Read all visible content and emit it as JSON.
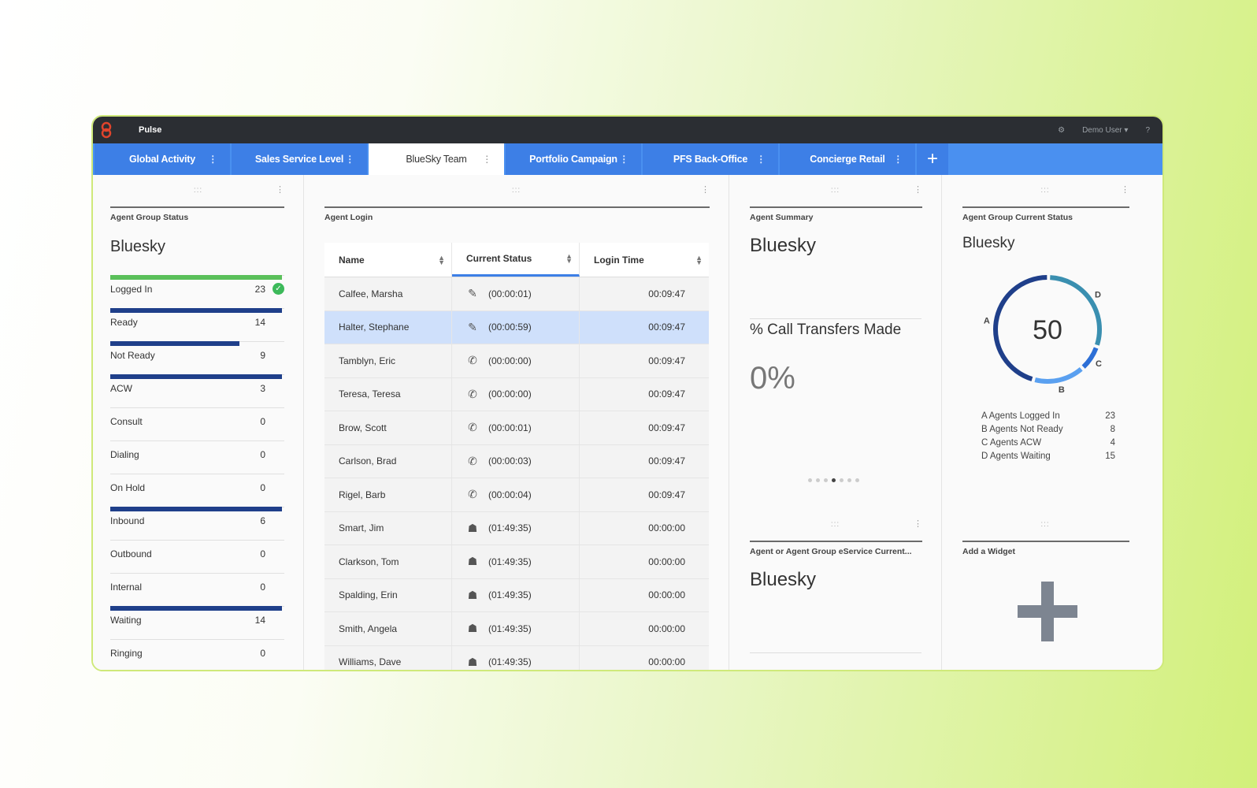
{
  "app": {
    "title": "Pulse",
    "user": "Demo User ▾",
    "help": "?",
    "settings": "⚙"
  },
  "tabs": [
    {
      "label": "Global Activity",
      "active": false
    },
    {
      "label": "Sales Service Level",
      "active": false
    },
    {
      "label": "BlueSky Team",
      "active": true
    },
    {
      "label": "Portfolio Campaign",
      "active": false
    },
    {
      "label": "PFS Back-Office",
      "active": false
    },
    {
      "label": "Concierge Retail",
      "active": false
    }
  ],
  "tab_add": "+",
  "group_status": {
    "header": "Agent Group Status",
    "title": "Bluesky",
    "rows": [
      {
        "label": "Logged In",
        "value": "23",
        "fill": 1.0,
        "color": "#5ac05a"
      },
      {
        "label": "Ready",
        "value": "14",
        "fill": 1.0,
        "color": "#1f3f8a"
      },
      {
        "label": "Not Ready",
        "value": "9",
        "fill": 0.75,
        "color": "#1f3f8a"
      },
      {
        "label": "ACW",
        "value": "3",
        "fill": 1.0,
        "color": "#1f3f8a"
      },
      {
        "label": "Consult",
        "value": "0",
        "fill": 0,
        "color": "#1f3f8a"
      },
      {
        "label": "Dialing",
        "value": "0",
        "fill": 0,
        "color": "#1f3f8a"
      },
      {
        "label": "On Hold",
        "value": "0",
        "fill": 0,
        "color": "#1f3f8a"
      },
      {
        "label": "Inbound",
        "value": "6",
        "fill": 1.0,
        "color": "#1f3f8a"
      },
      {
        "label": "Outbound",
        "value": "0",
        "fill": 0,
        "color": "#1f3f8a"
      },
      {
        "label": "Internal",
        "value": "0",
        "fill": 0,
        "color": "#1f3f8a"
      },
      {
        "label": "Waiting",
        "value": "14",
        "fill": 1.0,
        "color": "#1f3f8a"
      },
      {
        "label": "Ringing",
        "value": "0",
        "fill": 0,
        "color": "#1f3f8a"
      }
    ]
  },
  "agent_login": {
    "header": "Agent Login",
    "columns": [
      "Name",
      "Current Status",
      "Login Time"
    ],
    "rows": [
      {
        "name": "Calfee, Marsha",
        "icon": "edit-icon",
        "status": "(00:00:01)",
        "login": "00:09:47",
        "selected": false
      },
      {
        "name": "Halter, Stephane",
        "icon": "edit-icon",
        "status": "(00:00:59)",
        "login": "00:09:47",
        "selected": true
      },
      {
        "name": "Tamblyn, Eric",
        "icon": "phone-icon",
        "status": "(00:00:00)",
        "login": "00:09:47",
        "selected": false
      },
      {
        "name": "Teresa, Teresa",
        "icon": "phone-icon",
        "status": "(00:00:00)",
        "login": "00:09:47",
        "selected": false
      },
      {
        "name": "Brow, Scott",
        "icon": "phone-icon",
        "status": "(00:00:01)",
        "login": "00:09:47",
        "selected": false
      },
      {
        "name": "Carlson, Brad",
        "icon": "phone-icon",
        "status": "(00:00:03)",
        "login": "00:09:47",
        "selected": false
      },
      {
        "name": "Rigel, Barb",
        "icon": "phone-icon",
        "status": "(00:00:04)",
        "login": "00:09:47",
        "selected": false
      },
      {
        "name": "Smart, Jim",
        "icon": "agent-icon",
        "status": "(01:49:35)",
        "login": "00:00:00",
        "selected": false
      },
      {
        "name": "Clarkson, Tom",
        "icon": "agent-icon",
        "status": "(01:49:35)",
        "login": "00:00:00",
        "selected": false
      },
      {
        "name": "Spalding, Erin",
        "icon": "agent-icon",
        "status": "(01:49:35)",
        "login": "00:00:00",
        "selected": false
      },
      {
        "name": "Smith, Angela",
        "icon": "agent-icon",
        "status": "(01:49:35)",
        "login": "00:00:00",
        "selected": false
      },
      {
        "name": "Williams, Dave",
        "icon": "agent-icon",
        "status": "(01:49:35)",
        "login": "00:00:00",
        "selected": false
      }
    ]
  },
  "agent_summary": {
    "header": "Agent Summary",
    "title": "Bluesky",
    "metric_title": "% Call Transfers Made",
    "metric_value": "0%",
    "page_count": 7,
    "page_active": 4
  },
  "current_status": {
    "header": "Agent Group Current Status",
    "title": "Bluesky",
    "total": "50",
    "segments": [
      {
        "key": "A",
        "label": "Agents Logged In",
        "value": 23,
        "color": "#1f3f8a"
      },
      {
        "key": "B",
        "label": "Agents Not Ready",
        "value": 8,
        "color": "#5aa0f0"
      },
      {
        "key": "C",
        "label": "Agents ACW",
        "value": 4,
        "color": "#2d6fd6"
      },
      {
        "key": "D",
        "label": "Agents Waiting",
        "value": 15,
        "color": "#3a8fb0"
      }
    ]
  },
  "eservice": {
    "header": "Agent or Agent Group eService Current...",
    "title": "Bluesky"
  },
  "add_widget": {
    "header": "Add a Widget",
    "icon": "+"
  }
}
